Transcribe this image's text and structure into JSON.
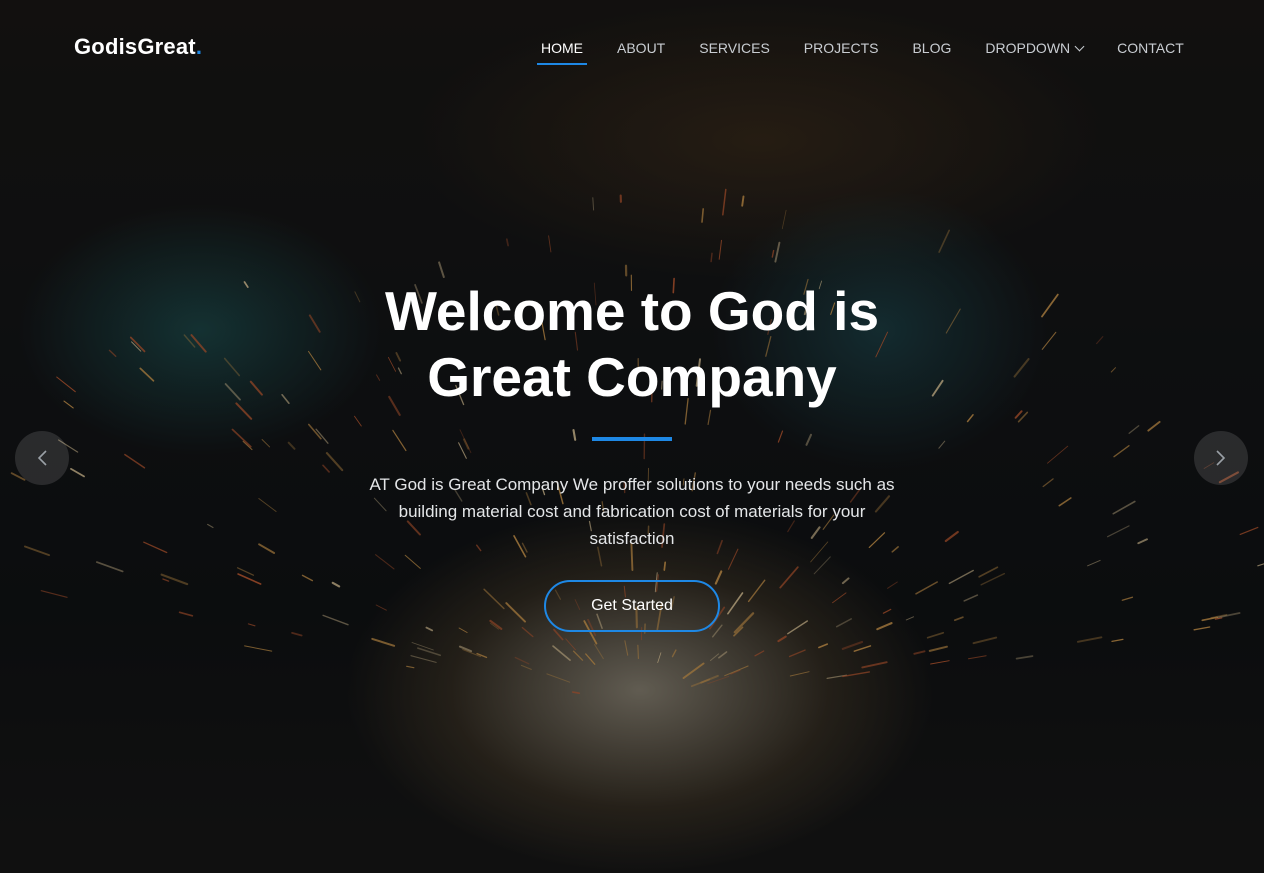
{
  "brand": {
    "name": "GodisGreat",
    "dot": "."
  },
  "nav": {
    "items": [
      {
        "label": "HOME",
        "active": true
      },
      {
        "label": "ABOUT"
      },
      {
        "label": "SERVICES"
      },
      {
        "label": "PROJECTS"
      },
      {
        "label": "BLOG"
      },
      {
        "label": "DROPDOWN",
        "icon": "chevron-down-icon"
      },
      {
        "label": "CONTACT"
      }
    ]
  },
  "hero": {
    "title": "Welcome to God is Great Company",
    "description": "AT God is Great Company We proffer solutions to your needs such as building material cost and fabrication cost of materials for your satisfaction",
    "cta_label": "Get Started",
    "prev_icon": "chevron-left-icon",
    "next_icon": "chevron-right-icon"
  },
  "colors": {
    "accent": "#1e88e5",
    "text": "#ffffff"
  }
}
